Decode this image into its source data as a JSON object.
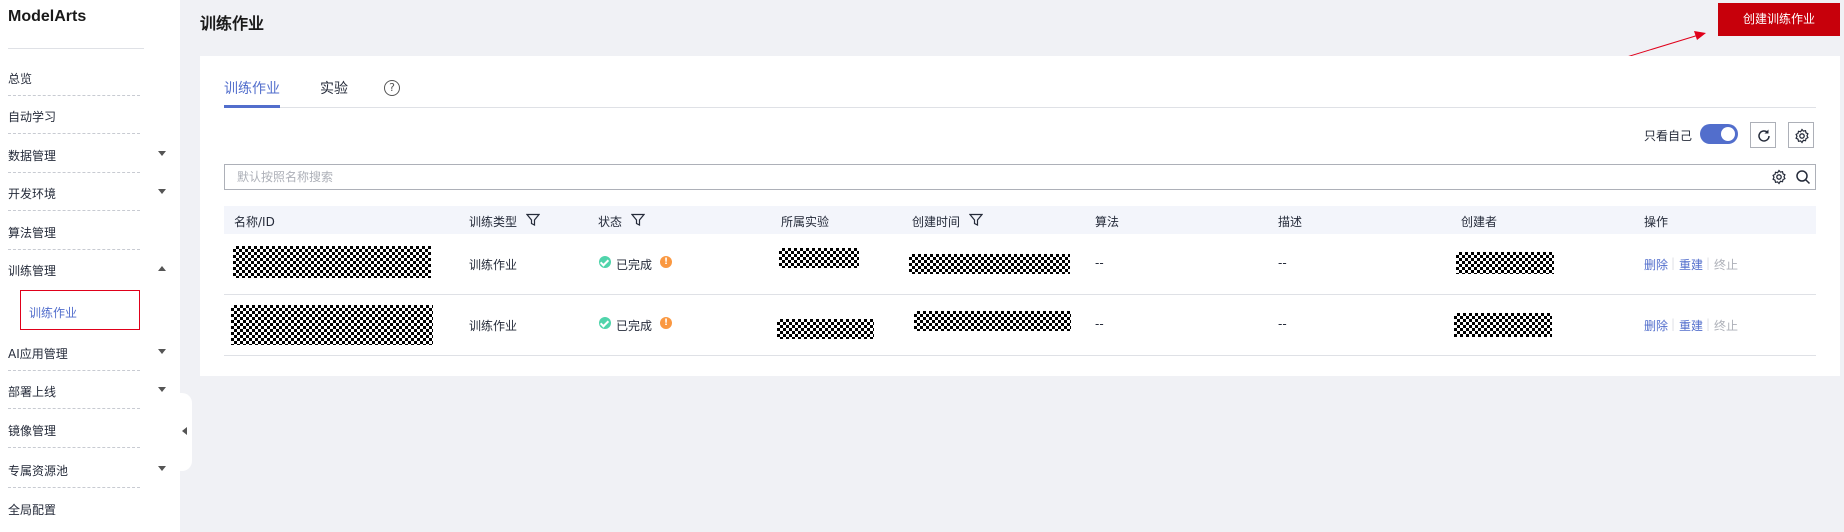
{
  "app": {
    "logo": "ModelArts"
  },
  "sidebar": {
    "items": [
      {
        "label": "总览",
        "caret": ""
      },
      {
        "label": "自动学习",
        "caret": ""
      },
      {
        "label": "数据管理",
        "caret": "down"
      },
      {
        "label": "开发环境",
        "caret": "down"
      },
      {
        "label": "算法管理",
        "caret": ""
      },
      {
        "label": "训练管理",
        "caret": "up"
      },
      {
        "label": "AI应用管理",
        "caret": "down"
      },
      {
        "label": "部署上线",
        "caret": "down"
      },
      {
        "label": "镜像管理",
        "caret": ""
      },
      {
        "label": "专属资源池",
        "caret": "down"
      },
      {
        "label": "全局配置",
        "caret": ""
      }
    ],
    "sub_item": "训练作业"
  },
  "header": {
    "title": "训练作业",
    "create_button": "创建训练作业"
  },
  "tabs": [
    {
      "label": "训练作业",
      "active": true
    },
    {
      "label": "实验",
      "active": false
    }
  ],
  "toolbar": {
    "only_mine_label": "只看自己",
    "only_mine_on": true
  },
  "search": {
    "placeholder": "默认按照名称搜索"
  },
  "table": {
    "columns": [
      "名称/ID",
      "训练类型",
      "状态",
      "所属实验",
      "创建时间",
      "算法",
      "描述",
      "创建者",
      "操作"
    ],
    "rows": [
      {
        "type": "训练作业",
        "status": "已完成",
        "algorithm": "--",
        "description": "--",
        "actions": [
          "删除",
          "重建",
          "终止"
        ]
      },
      {
        "type": "训练作业",
        "status": "已完成",
        "algorithm": "--",
        "description": "--",
        "actions": [
          "删除",
          "重建",
          "终止"
        ]
      }
    ]
  },
  "colors": {
    "accent": "#526ecc",
    "brand_red": "#c7000b",
    "success": "#50d4ab",
    "warning": "#fa9841"
  },
  "icons": {
    "help": "help-circle-icon",
    "refresh": "refresh-icon",
    "settings": "gear-icon",
    "search": "search-icon",
    "filter": "filter-icon"
  }
}
